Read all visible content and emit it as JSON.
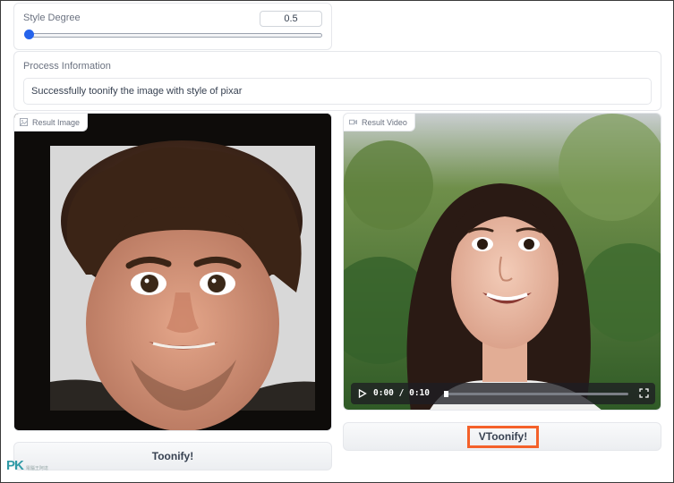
{
  "style_degree": {
    "label": "Style Degree",
    "value": "0.5",
    "slider_fraction": 0.0
  },
  "process_info": {
    "label": "Process Information",
    "message": "Successfully toonify the image with style of pixar"
  },
  "result_image": {
    "label": "Result Image",
    "icon": "image-icon"
  },
  "result_video": {
    "label": "Result Video",
    "icon": "video-icon",
    "current_time": "0:00",
    "separator": "/",
    "duration": "0:10",
    "progress_fraction": 0.0
  },
  "buttons": {
    "toonify": "Toonify!",
    "vtoonify": "VToonify!"
  },
  "watermark": {
    "logo": "PK",
    "tagline": "電腦王阿達"
  },
  "colors": {
    "slider_accent": "#2563eb",
    "highlight_border": "#f4612a"
  }
}
